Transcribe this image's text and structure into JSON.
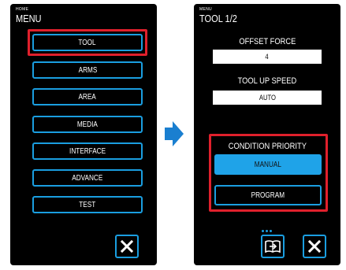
{
  "left": {
    "breadcrumb": "HOME",
    "title": "MENU",
    "items": [
      {
        "label": "TOOL"
      },
      {
        "label": "ARMS"
      },
      {
        "label": "AREA"
      },
      {
        "label": "MEDIA"
      },
      {
        "label": "INTERFACE"
      },
      {
        "label": "ADVANCE"
      },
      {
        "label": "TEST"
      }
    ],
    "close_icon": "close-x-icon"
  },
  "right": {
    "breadcrumb": "MENU",
    "title": "TOOL 1/2",
    "offset_force": {
      "label": "OFFSET FORCE",
      "value": "4"
    },
    "tool_up_speed": {
      "label": "TOOL UP SPEED",
      "value": "AUTO"
    },
    "condition_priority": {
      "label": "CONDITION PRIORITY",
      "options": [
        {
          "label": "MANUAL",
          "selected": true
        },
        {
          "label": "PROGRAM",
          "selected": false
        }
      ]
    },
    "book_icon": "book-next-page-icon",
    "close_icon": "close-x-icon"
  },
  "colors": {
    "accent": "#1a9ee0",
    "selected": "#1fa3e8",
    "highlight": "#e0202c",
    "screen_bg": "#000000"
  }
}
